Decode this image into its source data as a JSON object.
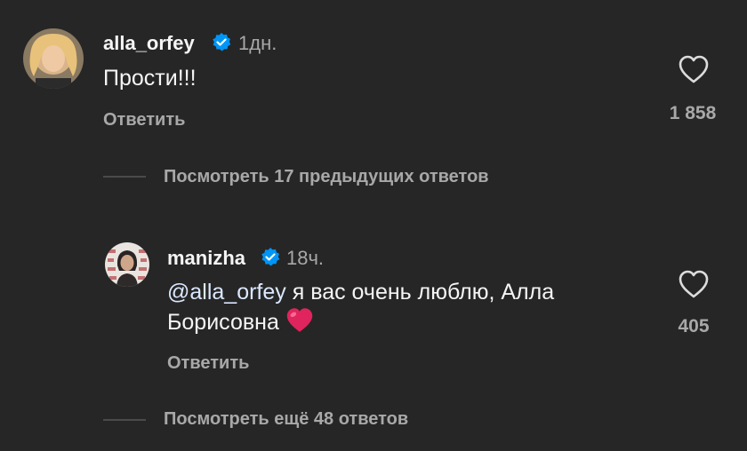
{
  "comment": {
    "username": "alla_orfey",
    "verified": true,
    "time": "1дн.",
    "text": "Прости!!!",
    "reply_label": "Ответить",
    "likes": "1 858",
    "avatar_icon": "user-avatar-photo"
  },
  "view_previous": {
    "label": "Посмотреть 17 предыдущих ответов"
  },
  "reply": {
    "username": "manizha",
    "verified": true,
    "time": "18ч.",
    "mention": "@alla_orfey",
    "text_line1": " я вас очень люблю, Алла",
    "text_line2": "Борисовна ",
    "emoji": "❤️",
    "reply_label": "Ответить",
    "likes": "405",
    "avatar_icon": "user-avatar-photo"
  },
  "view_more": {
    "label": "Посмотреть ещё 48 ответов"
  },
  "colors": {
    "background": "#262626",
    "primary_text": "#f5f5f5",
    "secondary_text": "#a8a8a8",
    "verified_badge": "#0095f6",
    "heart_emoji": "#e0245e"
  }
}
